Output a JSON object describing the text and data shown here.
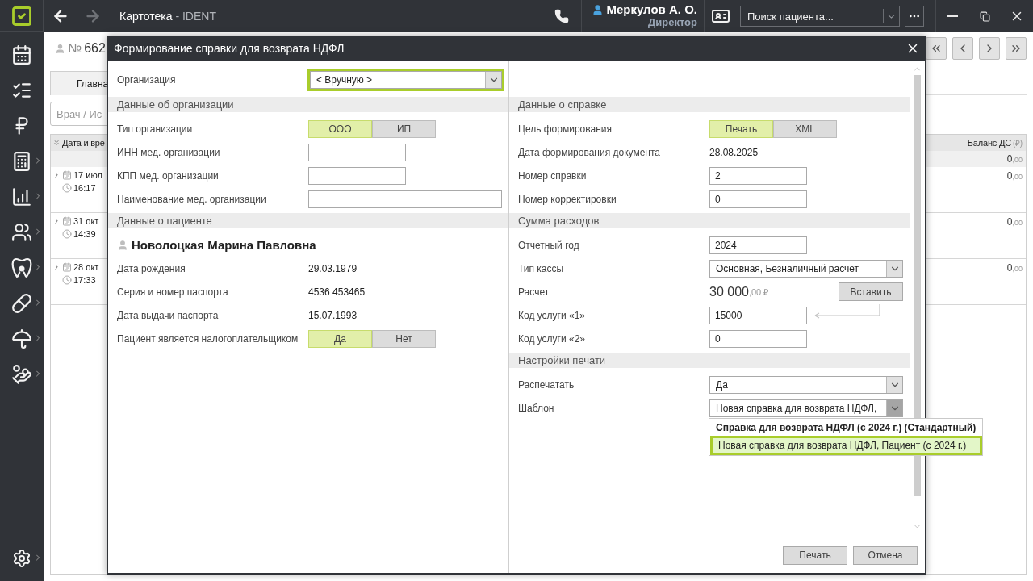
{
  "window": {
    "title": "Картотека",
    "app": "- IDENT"
  },
  "nav": {
    "back_enabled": true,
    "forward_enabled": false
  },
  "user": {
    "name": "Меркулов А. О.",
    "role": "Директор"
  },
  "patient_search": {
    "placeholder": "Поиск пациента..."
  },
  "sidebar": {
    "items": [
      {
        "submenu": false
      },
      {
        "submenu": false
      },
      {
        "submenu": false
      },
      {
        "submenu": true
      },
      {
        "submenu": true
      },
      {
        "submenu": true
      },
      {
        "submenu": true
      },
      {
        "submenu": true
      },
      {
        "submenu": true
      },
      {
        "submenu": true
      }
    ],
    "settings": {
      "submenu": true
    }
  },
  "card": {
    "number_sign": "№",
    "number": "662"
  },
  "tabs": [
    {
      "label": "Главна",
      "selected": true
    }
  ],
  "filter": {
    "placeholder": "Врач / Ис"
  },
  "visit_table": {
    "columns": [
      {
        "label": "Дата и вре"
      },
      {
        "label": "Баланс ДС",
        "unit": "(₽)"
      }
    ],
    "total": {
      "integer": "0",
      "fraction": ",00"
    },
    "rows": [
      {
        "date": "17 июл",
        "time": "16:17",
        "balance": {
          "integer": "0",
          "fraction": ",00"
        }
      },
      {
        "date": "31 окт",
        "time": "14:39",
        "balance": {
          "integer": "0",
          "fraction": ",00"
        }
      },
      {
        "date": "28 окт",
        "time": "17:33",
        "balance": {
          "integer": "0",
          "fraction": ",00"
        }
      }
    ]
  },
  "dialog": {
    "title": "Формирование справки для возврата НДФЛ",
    "organization": {
      "label": "Организация",
      "value": "< Вручную >",
      "highlighted": true
    },
    "left_sections": [
      {
        "title": "Данные об организации",
        "rows": [
          {
            "kind": "toggle",
            "label": "Тип организации",
            "options": [
              {
                "label": "ООО",
                "selected": true
              },
              {
                "label": "ИП",
                "selected": false
              }
            ]
          },
          {
            "kind": "input",
            "label": "ИНН мед. организации"
          },
          {
            "kind": "input",
            "label": "КПП мед. организации"
          },
          {
            "kind": "wide_input",
            "label": "Наименование мед. организации"
          }
        ]
      },
      {
        "title": "Данные о пациенте",
        "patient_name": "Новолоцкая Марина Павловна",
        "rows": [
          {
            "kind": "text",
            "label": "Дата рождения",
            "value": "29.03.1979"
          },
          {
            "kind": "text",
            "label": "Серия и номер паспорта",
            "value": "4536 453465"
          },
          {
            "kind": "text",
            "label": "Дата выдачи паспорта",
            "value": "15.07.1993"
          },
          {
            "kind": "toggle",
            "label": "Пациент является налогоплательщиком",
            "options": [
              {
                "label": "Да",
                "selected": true
              },
              {
                "label": "Нет",
                "selected": false
              }
            ]
          }
        ]
      }
    ],
    "right_sections": [
      {
        "title": "Данные о справке",
        "rows": [
          {
            "kind": "toggle",
            "label": "Цель формирования",
            "options": [
              {
                "label": "Печать",
                "selected": true
              },
              {
                "label": "XML",
                "selected": false
              }
            ]
          },
          {
            "kind": "text",
            "label": "Дата формирования документа",
            "value": "28.08.2025"
          },
          {
            "kind": "input",
            "label": "Номер справки",
            "value": "2"
          },
          {
            "kind": "input",
            "label": "Номер корректировки",
            "value": "0"
          }
        ]
      },
      {
        "title": "Сумма расходов",
        "rows": [
          {
            "kind": "input",
            "label": "Отчетный год",
            "value": "2024"
          },
          {
            "kind": "select",
            "label": "Тип кассы",
            "value": "Основная, Безналичный расчет",
            "open": false
          },
          {
            "kind": "amount",
            "label": "Расчет",
            "integer": "30 000",
            "fraction": ",00 ₽",
            "button": "Вставить"
          },
          {
            "kind": "input",
            "label": "Код услуги «1»",
            "value": "15000",
            "paste_arrow": true
          },
          {
            "kind": "input",
            "label": "Код услуги «2»",
            "value": "0"
          }
        ]
      },
      {
        "title": "Настройки печати",
        "rows": [
          {
            "kind": "select",
            "label": "Распечатать",
            "value": "Да",
            "open": false
          },
          {
            "kind": "select",
            "label": "Шаблон",
            "value": "Новая справка для возврата НДФЛ,",
            "open": true,
            "options": [
              {
                "label": "Справка для возврата НДФЛ (с 2024 г.) (Стандартный)",
                "default": true,
                "selected": false
              },
              {
                "label": "Новая справка для возврата НДФЛ, Пациент (с 2024 г.)",
                "default": false,
                "selected": true
              }
            ]
          }
        ]
      }
    ],
    "buttons": [
      {
        "label": "Печать"
      },
      {
        "label": "Отмена"
      }
    ]
  }
}
